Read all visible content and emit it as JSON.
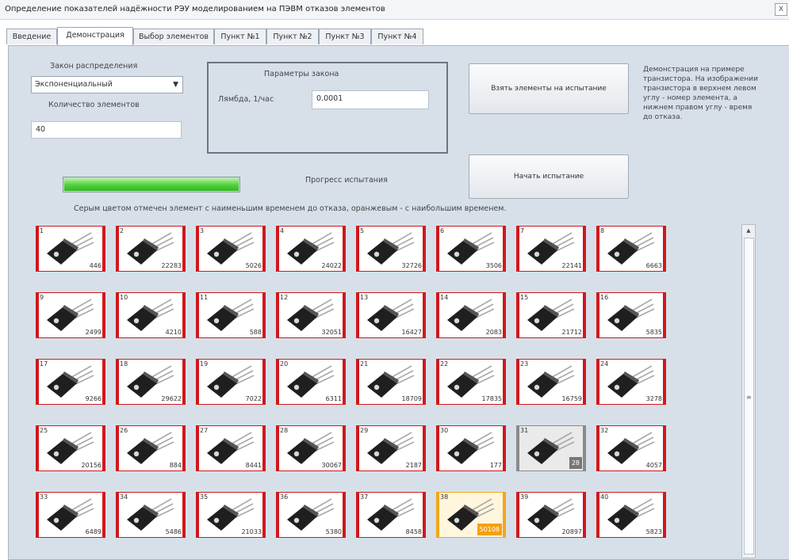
{
  "window": {
    "title": "Определение показателей надёжности РЭУ моделированием на ПЭВМ отказов элементов",
    "close_label": "X"
  },
  "tabs": [
    {
      "label": "Введение"
    },
    {
      "label": "Демонстрация"
    },
    {
      "label": "Выбор элементов"
    },
    {
      "label": "Пункт №1"
    },
    {
      "label": "Пункт №2"
    },
    {
      "label": "Пункт №3"
    },
    {
      "label": "Пункт №4"
    }
  ],
  "controls": {
    "distribution_label": "Закон распределения",
    "distribution_value": "Экспоненциальный",
    "count_label": "Количество элементов",
    "count_value": "40",
    "params_title": "Параметры закона",
    "lambda_label": "Лямбда, 1/час",
    "lambda_value": "0.0001",
    "take_button": "Взять элементы на испытание",
    "start_button": "Начать испытание",
    "progress_label": "Прогресс испытания",
    "progress_value": 1.0,
    "description": "Демонстрация на примере транзистора. На изображении транзистора в верхнем левом углу - номер элемента, а нижнем правом углу - время до отказа.",
    "hint": "Серым цветом отмечен элемент с наименьшим временем до отказа, оранжевым - с наибольшим временем."
  },
  "colors": {
    "normal_border": "#d0181c",
    "min_highlight": "#777777",
    "max_highlight": "#f4a10f",
    "progress": "#4fd03a"
  },
  "elements": [
    {
      "num": "1",
      "time": "446"
    },
    {
      "num": "2",
      "time": "22283"
    },
    {
      "num": "3",
      "time": "5026"
    },
    {
      "num": "4",
      "time": "24022"
    },
    {
      "num": "5",
      "time": "32726"
    },
    {
      "num": "6",
      "time": "3506"
    },
    {
      "num": "7",
      "time": "22141"
    },
    {
      "num": "8",
      "time": "6663"
    },
    {
      "num": "9",
      "time": "2499"
    },
    {
      "num": "10",
      "time": "4210"
    },
    {
      "num": "11",
      "time": "588"
    },
    {
      "num": "12",
      "time": "32051"
    },
    {
      "num": "13",
      "time": "16427"
    },
    {
      "num": "14",
      "time": "2083"
    },
    {
      "num": "15",
      "time": "21712"
    },
    {
      "num": "16",
      "time": "5835"
    },
    {
      "num": "17",
      "time": "9266"
    },
    {
      "num": "18",
      "time": "29622"
    },
    {
      "num": "19",
      "time": "7022"
    },
    {
      "num": "20",
      "time": "6311"
    },
    {
      "num": "21",
      "time": "18709"
    },
    {
      "num": "22",
      "time": "17835"
    },
    {
      "num": "23",
      "time": "16759"
    },
    {
      "num": "24",
      "time": "3278"
    },
    {
      "num": "25",
      "time": "20156"
    },
    {
      "num": "26",
      "time": "884"
    },
    {
      "num": "27",
      "time": "8441"
    },
    {
      "num": "28",
      "time": "30067"
    },
    {
      "num": "29",
      "time": "2187"
    },
    {
      "num": "30",
      "time": "177"
    },
    {
      "num": "31",
      "time": "28",
      "state": "min"
    },
    {
      "num": "32",
      "time": "4057"
    },
    {
      "num": "33",
      "time": "6489"
    },
    {
      "num": "34",
      "time": "5486"
    },
    {
      "num": "35",
      "time": "21033"
    },
    {
      "num": "36",
      "time": "5380"
    },
    {
      "num": "37",
      "time": "8458"
    },
    {
      "num": "38",
      "time": "50108",
      "state": "max"
    },
    {
      "num": "39",
      "time": "20897"
    },
    {
      "num": "40",
      "time": "5823"
    }
  ]
}
